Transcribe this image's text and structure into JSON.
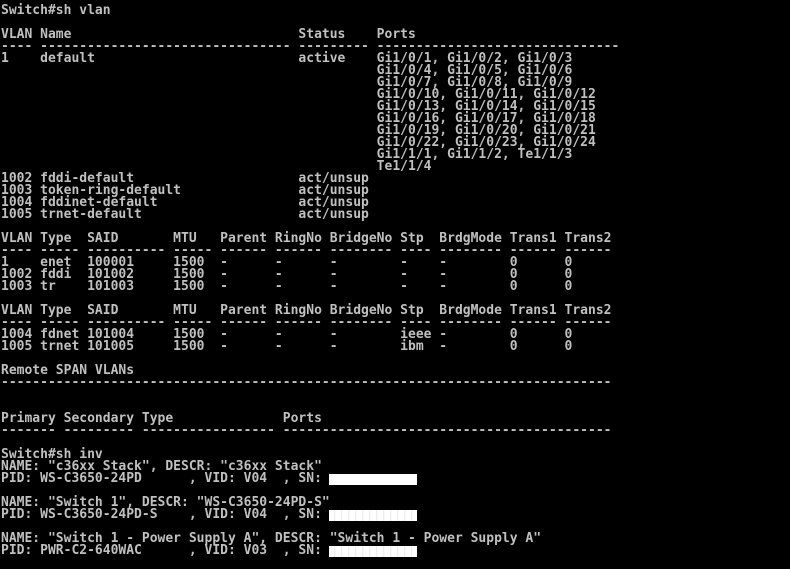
{
  "terminal": {
    "lines": [
      "Switch#sh vlan",
      "",
      "VLAN Name                             Status    Ports",
      "---- -------------------------------- --------- -------------------------------",
      "1    default                          active    Gi1/0/1, Gi1/0/2, Gi1/0/3",
      "                                                Gi1/0/4, Gi1/0/5, Gi1/0/6",
      "                                                Gi1/0/7, Gi1/0/8, Gi1/0/9",
      "                                                Gi1/0/10, Gi1/0/11, Gi1/0/12",
      "                                                Gi1/0/13, Gi1/0/14, Gi1/0/15",
      "                                                Gi1/0/16, Gi1/0/17, Gi1/0/18",
      "                                                Gi1/0/19, Gi1/0/20, Gi1/0/21",
      "                                                Gi1/0/22, Gi1/0/23, Gi1/0/24",
      "                                                Gi1/1/1, Gi1/1/2, Te1/1/3",
      "                                                Te1/1/4",
      "1002 fddi-default                     act/unsup",
      "1003 token-ring-default               act/unsup",
      "1004 fddinet-default                  act/unsup",
      "1005 trnet-default                    act/unsup",
      "",
      "VLAN Type  SAID       MTU   Parent RingNo BridgeNo Stp  BrdgMode Trans1 Trans2",
      "---- ----- ---------- ----- ------ ------ -------- ---- -------- ------ ------",
      "1    enet  100001     1500  -      -      -        -    -        0      0",
      "1002 fddi  101002     1500  -      -      -        -    -        0      0",
      "1003 tr    101003     1500  -      -      -        -    -        0      0",
      "",
      "VLAN Type  SAID       MTU   Parent RingNo BridgeNo Stp  BrdgMode Trans1 Trans2",
      "---- ----- ---------- ----- ------ ------ -------- ---- -------- ------ ------",
      "1004 fdnet 101004     1500  -      -      -        ieee -        0      0",
      "1005 trnet 101005     1500  -      -      -        ibm  -        0      0",
      "",
      "Remote SPAN VLANs",
      "------------------------------------------------------------------------------",
      "",
      "",
      "Primary Secondary Type              Ports",
      "------- --------- ----------------- ------------------------------------------",
      "",
      "Switch#sh inv",
      "NAME: \"c36xx Stack\", DESCR: \"c36xx Stack\"",
      "PID: WS-C3650-24PD      , VID: V04  , SN: ",
      "",
      "NAME: \"Switch 1\", DESCR: \"WS-C3650-24PD-S\"",
      "PID: WS-C3650-24PD-S    , VID: V04  , SN: ",
      "",
      "NAME: \"Switch 1 - Power Supply A\", DESCR: \"Switch 1 - Power Supply A\"",
      "PID: PWR-C2-640WAC      , VID: V03  , SN: "
    ]
  }
}
